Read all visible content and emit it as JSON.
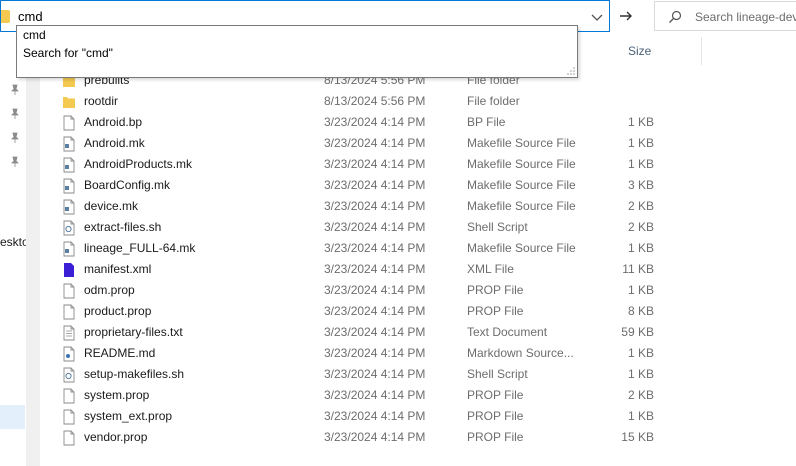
{
  "address": {
    "value": "cmd"
  },
  "search": {
    "placeholder": "Search lineage-dev"
  },
  "suggestions": [
    {
      "label": "cmd"
    },
    {
      "label": "Search for \"cmd\""
    }
  ],
  "nav": {
    "partial_label": "eskto"
  },
  "columns": {
    "size": "Size"
  },
  "files": [
    {
      "name": "prebuilts",
      "date": "8/13/2024 5:56 PM",
      "type": "File folder",
      "size": "",
      "icon": "folder-icon"
    },
    {
      "name": "rootdir",
      "date": "8/13/2024 5:56 PM",
      "type": "File folder",
      "size": "",
      "icon": "folder-icon"
    },
    {
      "name": "Android.bp",
      "date": "3/23/2024 4:14 PM",
      "type": "BP File",
      "size": "1 KB",
      "icon": "file-icon"
    },
    {
      "name": "Android.mk",
      "date": "3/23/2024 4:14 PM",
      "type": "Makefile Source File",
      "size": "1 KB",
      "icon": "makefile-icon"
    },
    {
      "name": "AndroidProducts.mk",
      "date": "3/23/2024 4:14 PM",
      "type": "Makefile Source File",
      "size": "1 KB",
      "icon": "makefile-icon"
    },
    {
      "name": "BoardConfig.mk",
      "date": "3/23/2024 4:14 PM",
      "type": "Makefile Source File",
      "size": "3 KB",
      "icon": "makefile-icon"
    },
    {
      "name": "device.mk",
      "date": "3/23/2024 4:14 PM",
      "type": "Makefile Source File",
      "size": "2 KB",
      "icon": "makefile-icon"
    },
    {
      "name": "extract-files.sh",
      "date": "3/23/2024 4:14 PM",
      "type": "Shell Script",
      "size": "2 KB",
      "icon": "shell-script-icon"
    },
    {
      "name": "lineage_FULL-64.mk",
      "date": "3/23/2024 4:14 PM",
      "type": "Makefile Source File",
      "size": "1 KB",
      "icon": "makefile-icon"
    },
    {
      "name": "manifest.xml",
      "date": "3/23/2024 4:14 PM",
      "type": "XML File",
      "size": "11 KB",
      "icon": "xml-file-icon"
    },
    {
      "name": "odm.prop",
      "date": "3/23/2024 4:14 PM",
      "type": "PROP File",
      "size": "1 KB",
      "icon": "file-icon"
    },
    {
      "name": "product.prop",
      "date": "3/23/2024 4:14 PM",
      "type": "PROP File",
      "size": "8 KB",
      "icon": "file-icon"
    },
    {
      "name": "proprietary-files.txt",
      "date": "3/23/2024 4:14 PM",
      "type": "Text Document",
      "size": "59 KB",
      "icon": "text-file-icon"
    },
    {
      "name": "README.md",
      "date": "3/23/2024 4:14 PM",
      "type": "Markdown Source...",
      "size": "1 KB",
      "icon": "markdown-icon"
    },
    {
      "name": "setup-makefiles.sh",
      "date": "3/23/2024 4:14 PM",
      "type": "Shell Script",
      "size": "1 KB",
      "icon": "shell-script-icon"
    },
    {
      "name": "system.prop",
      "date": "3/23/2024 4:14 PM",
      "type": "PROP File",
      "size": "2 KB",
      "icon": "file-icon"
    },
    {
      "name": "system_ext.prop",
      "date": "3/23/2024 4:14 PM",
      "type": "PROP File",
      "size": "1 KB",
      "icon": "file-icon"
    },
    {
      "name": "vendor.prop",
      "date": "3/23/2024 4:14 PM",
      "type": "PROP File",
      "size": "15 KB",
      "icon": "file-icon"
    }
  ],
  "colors": {
    "accent": "#0078d7",
    "folder": "#f3c94f",
    "xml": "#3b1fd6"
  }
}
